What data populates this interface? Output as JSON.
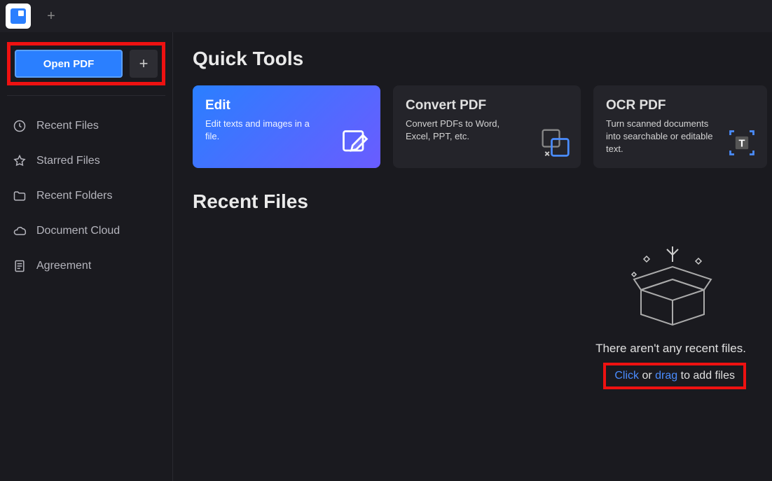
{
  "titlebar": {
    "plus": "+"
  },
  "sidebar": {
    "open_label": "Open PDF",
    "plus": "+",
    "items": [
      {
        "label": "Recent Files",
        "icon": "clock-icon"
      },
      {
        "label": "Starred Files",
        "icon": "star-icon"
      },
      {
        "label": "Recent Folders",
        "icon": "folder-icon"
      },
      {
        "label": "Document Cloud",
        "icon": "cloud-icon"
      },
      {
        "label": "Agreement",
        "icon": "document-icon"
      }
    ]
  },
  "main": {
    "quick_tools_title": "Quick Tools",
    "tools": [
      {
        "title": "Edit",
        "desc": "Edit texts and images in a file."
      },
      {
        "title": "Convert PDF",
        "desc": "Convert PDFs to Word, Excel, PPT, etc."
      },
      {
        "title": "OCR PDF",
        "desc": "Turn scanned documents into searchable or editable text."
      }
    ],
    "recent_title": "Recent Files",
    "empty_msg": "There aren't any recent files.",
    "drop": {
      "click": "Click",
      "or": " or ",
      "drag": "drag",
      "rest": " to add files"
    }
  }
}
